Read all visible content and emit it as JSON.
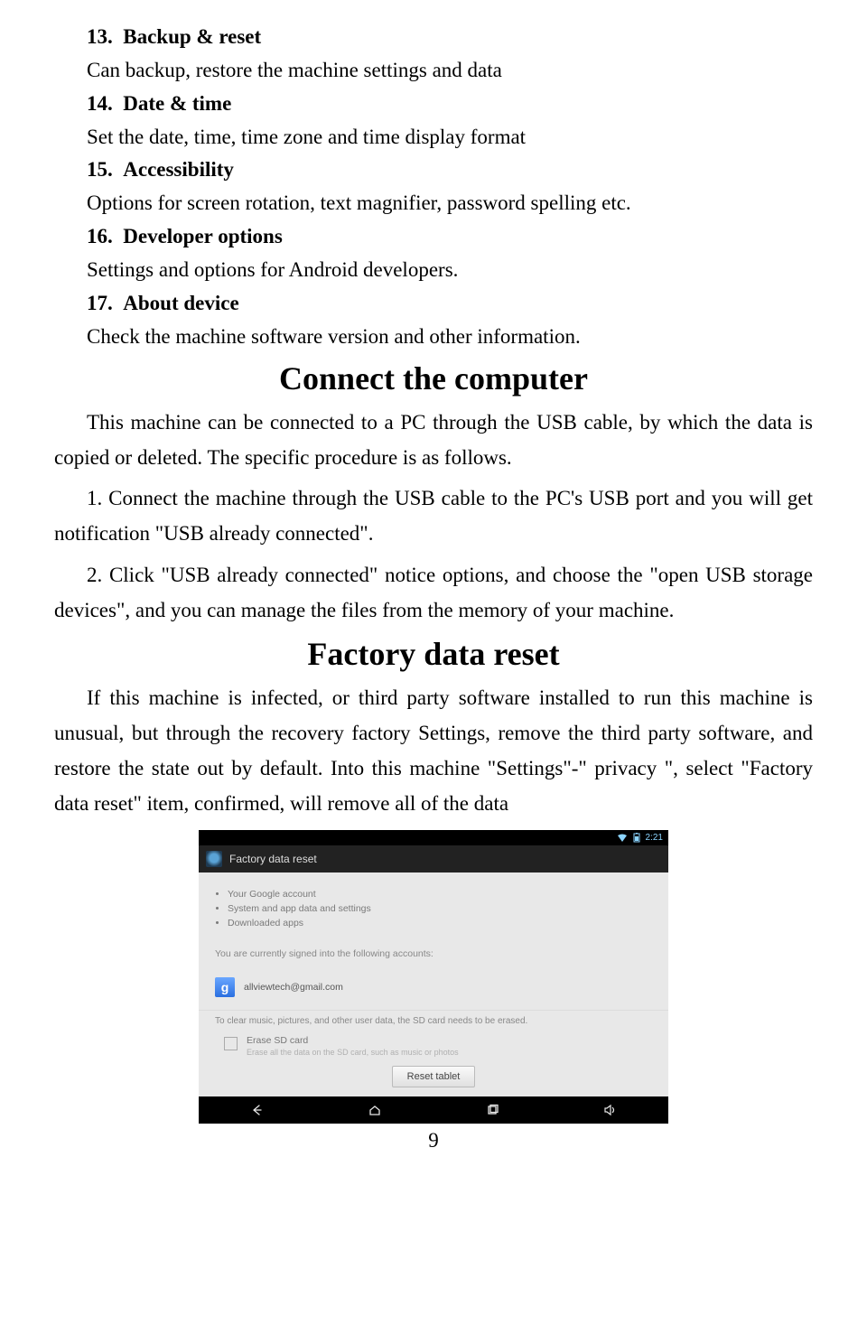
{
  "sections": [
    {
      "num": "13.",
      "title": "Backup & reset",
      "body": "Can backup, restore the machine settings and data"
    },
    {
      "num": "14.",
      "title": "Date & time",
      "body": "Set the date, time, time zone and time display format"
    },
    {
      "num": "15.",
      "title": "Accessibility",
      "body": "Options for screen rotation, text magnifier, password spelling etc."
    },
    {
      "num": "16.",
      "title": "Developer options",
      "body": "Settings and options for Android developers."
    },
    {
      "num": "17.",
      "title": "About device",
      "body": "Check the machine software version and other information."
    }
  ],
  "connect": {
    "heading": "Connect the computer",
    "p1": "This machine can be connected to a PC through the USB cable, by which the data is copied or deleted. The specific procedure is as follows.",
    "step1": "1. Connect the machine through the USB cable to the PC's USB port and you will get notification \"USB already connected\".",
    "step2": "2. Click \"USB already connected\" notice options, and choose the \"open USB storage devices\", and you can manage the files from the memory of your machine."
  },
  "factory": {
    "heading": "Factory data reset",
    "p1": "If this machine is infected, or third party software installed to run this machine is unusual, but through the recovery factory Settings, remove the third party software, and restore the state out by default. Into this machine \"Settings\"-\" privacy \", select \"Factory data reset\" item, confirmed, will remove all of the data"
  },
  "screenshot": {
    "status_time": "2:21",
    "title": "Factory data reset",
    "bullets": [
      "Your Google account",
      "System and app data and settings",
      "Downloaded apps"
    ],
    "signed_text": "You are currently signed into the following accounts:",
    "google_glyph": "g",
    "account_email": "allviewtech@gmail.com",
    "erase_note": "To clear music, pictures, and other user data, the SD card needs to be erased.",
    "erase_label": "Erase SD card",
    "erase_sub": "Erase all the data on the SD card, such as music or photos",
    "reset_button": "Reset tablet"
  },
  "page_number": "9"
}
